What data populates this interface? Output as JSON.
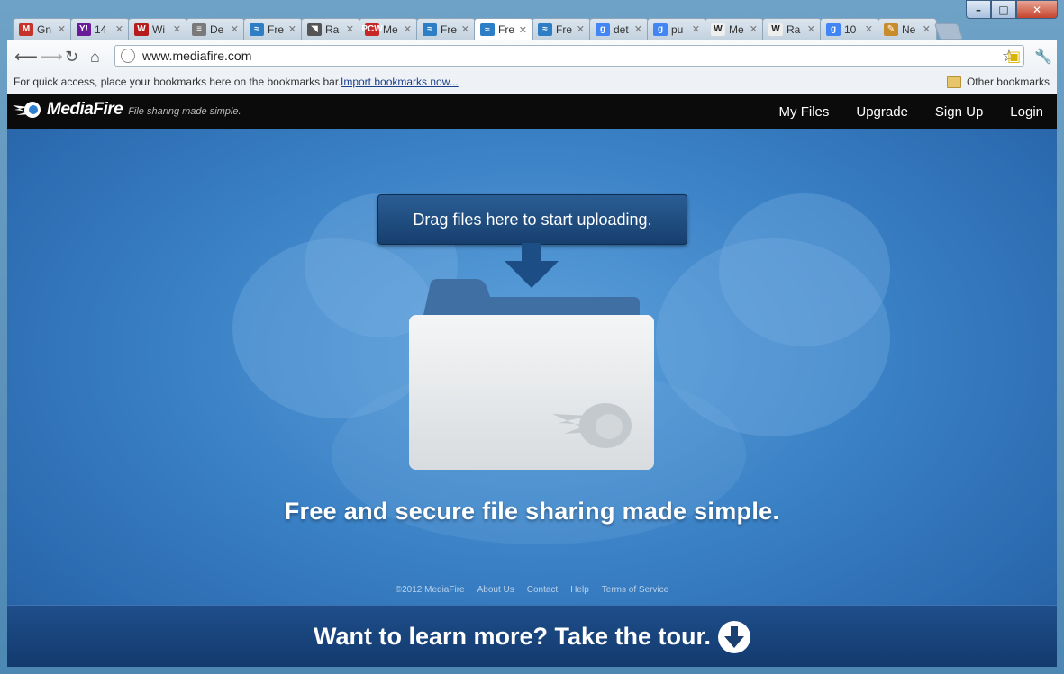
{
  "window": {
    "controls": {
      "minimize": "–",
      "maximize": "□",
      "close": "✕"
    }
  },
  "tabs": [
    {
      "title": "Gn",
      "favicon": "gmail-icon",
      "color": "#c5332a",
      "glyph": "M"
    },
    {
      "title": "14",
      "favicon": "yahoo-icon",
      "color": "#6a1b9a",
      "glyph": "Y!"
    },
    {
      "title": "Wi",
      "favicon": "w-red-icon",
      "color": "#b71c1c",
      "glyph": "W"
    },
    {
      "title": "De",
      "favicon": "flag-icon",
      "color": "#7a7a7a",
      "glyph": "≡"
    },
    {
      "title": "Fre",
      "favicon": "mediafire-icon",
      "color": "#2d7ec4",
      "glyph": "≈"
    },
    {
      "title": "Ra",
      "favicon": "rapid-icon",
      "color": "#555555",
      "glyph": "◥"
    },
    {
      "title": "Me",
      "favicon": "pcw-icon",
      "color": "#c62828",
      "glyph": "PCW"
    },
    {
      "title": "Fre",
      "favicon": "mediafire-icon",
      "color": "#2d7ec4",
      "glyph": "≈"
    },
    {
      "title": "Fre",
      "favicon": "mediafire-icon",
      "color": "#2d7ec4",
      "glyph": "≈",
      "active": true
    },
    {
      "title": "Fre",
      "favicon": "mediafire-icon",
      "color": "#2d7ec4",
      "glyph": "≈"
    },
    {
      "title": "det",
      "favicon": "google-icon",
      "color": "#4285f4",
      "glyph": "g"
    },
    {
      "title": "pu",
      "favicon": "google-icon",
      "color": "#4285f4",
      "glyph": "g"
    },
    {
      "title": "Me",
      "favicon": "wikipedia-icon",
      "color": "#eeeeee",
      "glyph": "W"
    },
    {
      "title": "Ra",
      "favicon": "wikipedia-icon",
      "color": "#eeeeee",
      "glyph": "W"
    },
    {
      "title": "10",
      "favicon": "google-icon",
      "color": "#4285f4",
      "glyph": "g"
    },
    {
      "title": "Ne",
      "favicon": "wrench-tab-icon",
      "color": "#c98c2c",
      "glyph": "✎"
    }
  ],
  "toolbar": {
    "url": "www.mediafire.com"
  },
  "bookmarks": {
    "message": "For quick access, place your bookmarks here on the bookmarks bar.",
    "import_link": "Import bookmarks now...",
    "other": "Other bookmarks"
  },
  "site": {
    "logo": "MediaFire",
    "tagline": "File sharing made simple.",
    "nav": [
      "My Files",
      "Upgrade",
      "Sign Up",
      "Login"
    ],
    "callout": "Drag files here to start uploading.",
    "headline": "Free and secure file sharing made simple.",
    "footer": [
      "©2012 MediaFire",
      "About Us",
      "Contact",
      "Help",
      "Terms of Service"
    ],
    "tour": "Want to learn more? Take the tour."
  }
}
